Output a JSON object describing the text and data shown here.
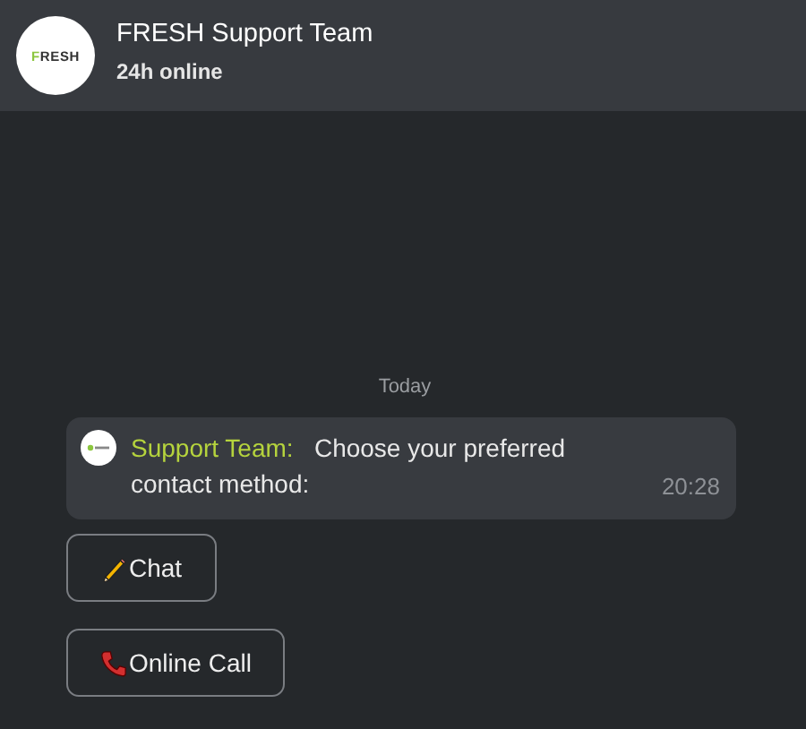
{
  "header": {
    "logo_text": "FRESH",
    "title": "FRESH Support Team",
    "status": "24h online"
  },
  "date_divider": "Today",
  "message": {
    "sender": "Support Team:",
    "text": "Choose your preferred contact method:",
    "time": "20:28"
  },
  "options": [
    {
      "label": "Chat",
      "kind": "chat"
    },
    {
      "label": "Online Call",
      "kind": "call"
    }
  ]
}
